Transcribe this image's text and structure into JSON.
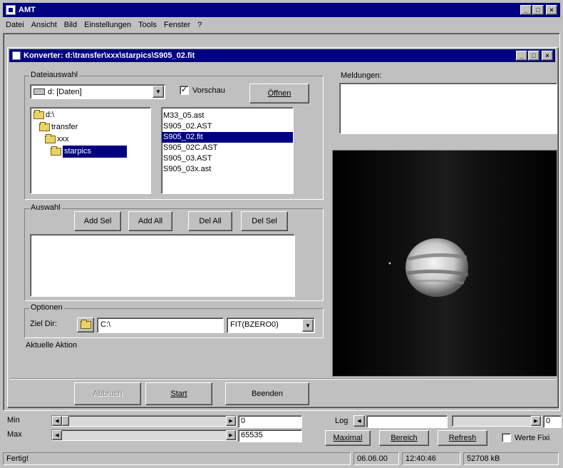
{
  "app": {
    "title": "AMT",
    "menu": [
      "Datei",
      "Ansicht",
      "Bild",
      "Einstellungen",
      "Tools",
      "Fenster",
      "?"
    ]
  },
  "child": {
    "title": "Konverter: d:\\transfer\\xxx\\starpics\\S905_02.fit"
  },
  "dateiauswahl": {
    "label": "Dateiauswahl",
    "drive": "d: [Daten]",
    "vorschau_label": "Vorschau",
    "vorschau_checked": true,
    "oeffnen_label": "Öffnen",
    "tree": [
      {
        "label": "d:\\",
        "level": 0,
        "selected": false
      },
      {
        "label": "transfer",
        "level": 1,
        "selected": false
      },
      {
        "label": "xxx",
        "level": 2,
        "selected": false
      },
      {
        "label": "starpics",
        "level": 3,
        "selected": true
      }
    ],
    "files": [
      {
        "name": "M33_05.ast",
        "selected": false
      },
      {
        "name": "S905_02.AST",
        "selected": false
      },
      {
        "name": "S905_02.fit",
        "selected": true
      },
      {
        "name": "S905_02C.AST",
        "selected": false
      },
      {
        "name": "S905_03.AST",
        "selected": false
      },
      {
        "name": "S905_03x.ast",
        "selected": false
      }
    ]
  },
  "auswahl": {
    "label": "Auswahl",
    "add_sel": "Add Sel",
    "add_all": "Add All",
    "del_all": "Del All",
    "del_sel": "Del Sel"
  },
  "optionen": {
    "label": "Optionen",
    "ziel_dir_label": "Ziel Dir:",
    "ziel_dir_value": "C:\\",
    "format_value": "FIT(BZERO0)"
  },
  "aktuelle_aktion": "Aktuelle Aktion",
  "meldungen_label": "Meldungen:",
  "footer_buttons": {
    "abbruch": "Abbruch",
    "start": "Start",
    "beenden": "Beenden"
  },
  "controls": {
    "min_label": "Min",
    "max_label": "Max",
    "min_value": "0",
    "max_value": "65535",
    "log_label": "Log",
    "right_value": "0",
    "maximal": "Maximal",
    "bereich": "Bereich",
    "refresh": "Refresh",
    "werte_label": "Werte Fixi"
  },
  "status": {
    "text": "Fertig!",
    "date": "06.06.00",
    "time": "12:40:46",
    "memory": "52708 kB"
  },
  "colors": {
    "title_bar": "#000080",
    "selection": "#000080",
    "face": "#c0c0c0",
    "preview_bg": "#000000"
  }
}
